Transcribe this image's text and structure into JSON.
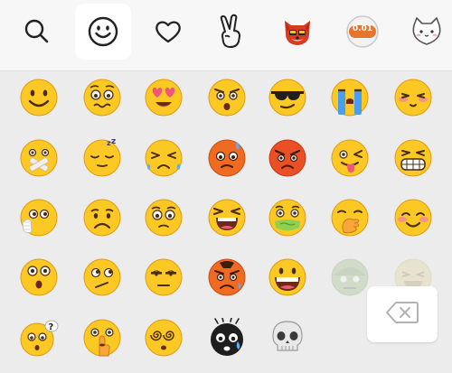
{
  "colors": {
    "background": "#ececec",
    "tabbar_background": "#f7f7f7",
    "active_tab": "#ffffff",
    "emoji_yellow": "#fcc924",
    "emoji_orange": "#f06a22"
  },
  "tabbar": {
    "tabs": [
      {
        "name": "search",
        "icon": "search-icon"
      },
      {
        "name": "emoji",
        "icon": "smiley-icon",
        "active": true
      },
      {
        "name": "favorites",
        "icon": "heart-icon"
      },
      {
        "name": "gestures",
        "icon": "victory-hand-icon"
      },
      {
        "name": "sticker-pack-fox",
        "icon": "fox-sticker-icon"
      },
      {
        "name": "sticker-pack-coin",
        "icon": "coin-sticker-icon",
        "label": "0.01"
      },
      {
        "name": "sticker-pack-cat",
        "icon": "white-cat-sticker-icon"
      }
    ]
  },
  "emoji_grid": {
    "rows": [
      [
        "smile",
        "pleading-wavy",
        "heart-eyes",
        "surprised-frown",
        "sunglasses",
        "crying-tears",
        "blush-squint"
      ],
      [
        "zipped-bandage",
        "sleeping",
        "squint-sweat",
        "orange-sweat",
        "angry-red",
        "wink-tongue",
        "grin-teeth"
      ],
      [
        "covered-mouth",
        "frown",
        "worried-eyes",
        "screaming-cry",
        "nauseated",
        "hand-over-mouth",
        "blushing-smile"
      ],
      [
        "shocked-eyes",
        "side-eye",
        "unamused",
        "orange-bruised",
        "big-grin",
        "zombie-faded",
        "laughing-faded"
      ],
      [
        "question-confused",
        "shush",
        "dizzy-swirl",
        "black-tearful",
        "skull"
      ]
    ]
  },
  "backspace": {
    "icon": "backspace-icon"
  }
}
